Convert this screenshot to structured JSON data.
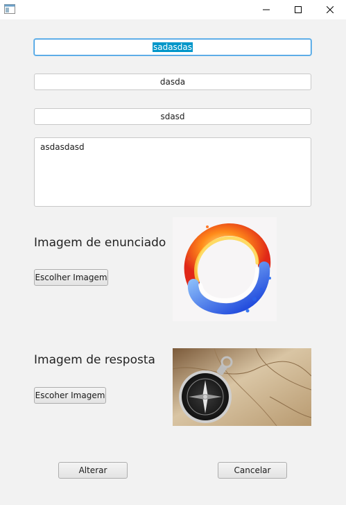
{
  "window": {
    "icon": "app-window-icon",
    "controls": [
      "minimize-icon",
      "maximize-icon",
      "close-icon"
    ]
  },
  "form": {
    "field1_value": "sadasdas",
    "field2_value": "dasda",
    "field3_value": "sdasd",
    "textarea_value": "asdasdasd"
  },
  "enunciado": {
    "label": "Imagem de enunciado",
    "button_label": "Escolher Imagem",
    "image_icon": "fire-water-ring-image"
  },
  "resposta": {
    "label": "Imagem de resposta",
    "button_label": "Escoher Imagem",
    "image_icon": "compass-on-map-image"
  },
  "actions": {
    "alterar_label": "Alterar",
    "cancelar_label": "Cancelar"
  },
  "colors": {
    "accent": "#0096c9",
    "focus_border": "#3c9ae0",
    "background": "#f2f2f2"
  }
}
